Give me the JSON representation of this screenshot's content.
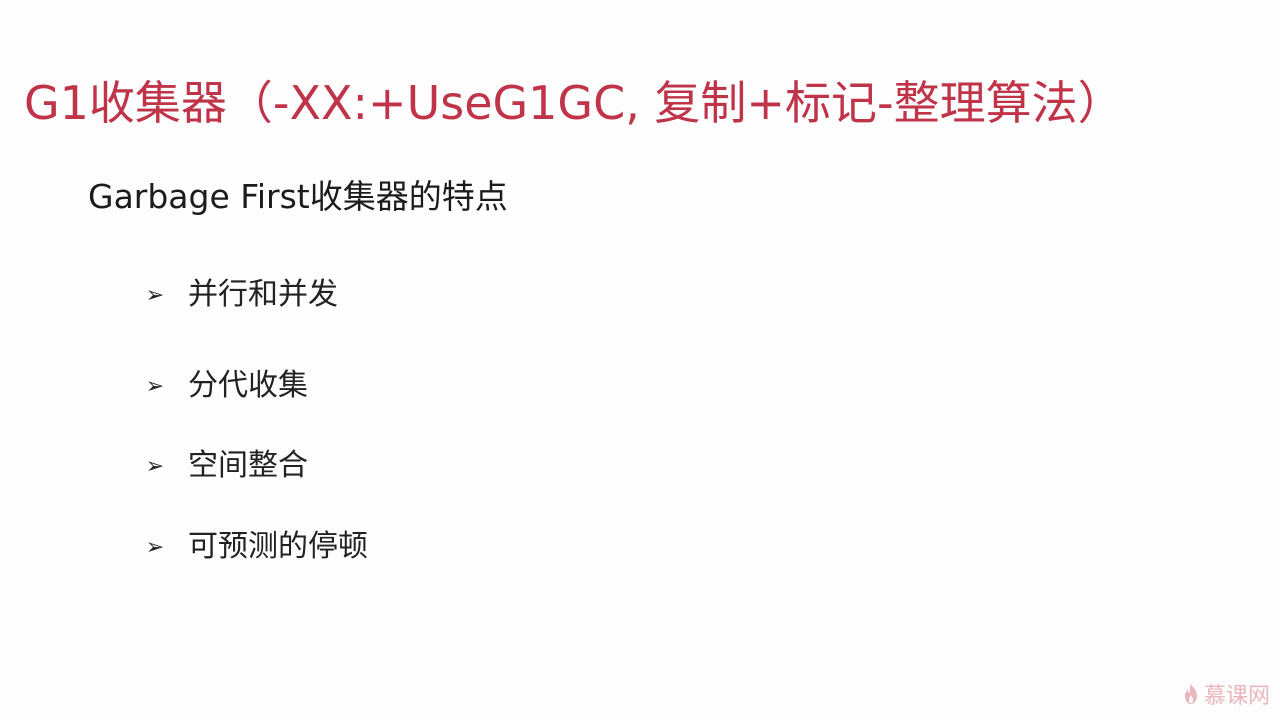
{
  "slide": {
    "title": "G1收集器（-XX:+UseG1GC, 复制+标记-整理算法）",
    "subtitle": "Garbage First收集器的特点",
    "bullet_marker": "➢",
    "bullets": [
      {
        "text": "并行和并发"
      },
      {
        "text": "分代收集"
      },
      {
        "text": "空间整合"
      },
      {
        "text": "可预测的停顿"
      }
    ]
  },
  "watermark": {
    "text": "慕课网",
    "icon": "flame-logo-icon",
    "color": "#e9b7bd"
  },
  "colors": {
    "title": "#c0344a",
    "text": "#222222"
  }
}
